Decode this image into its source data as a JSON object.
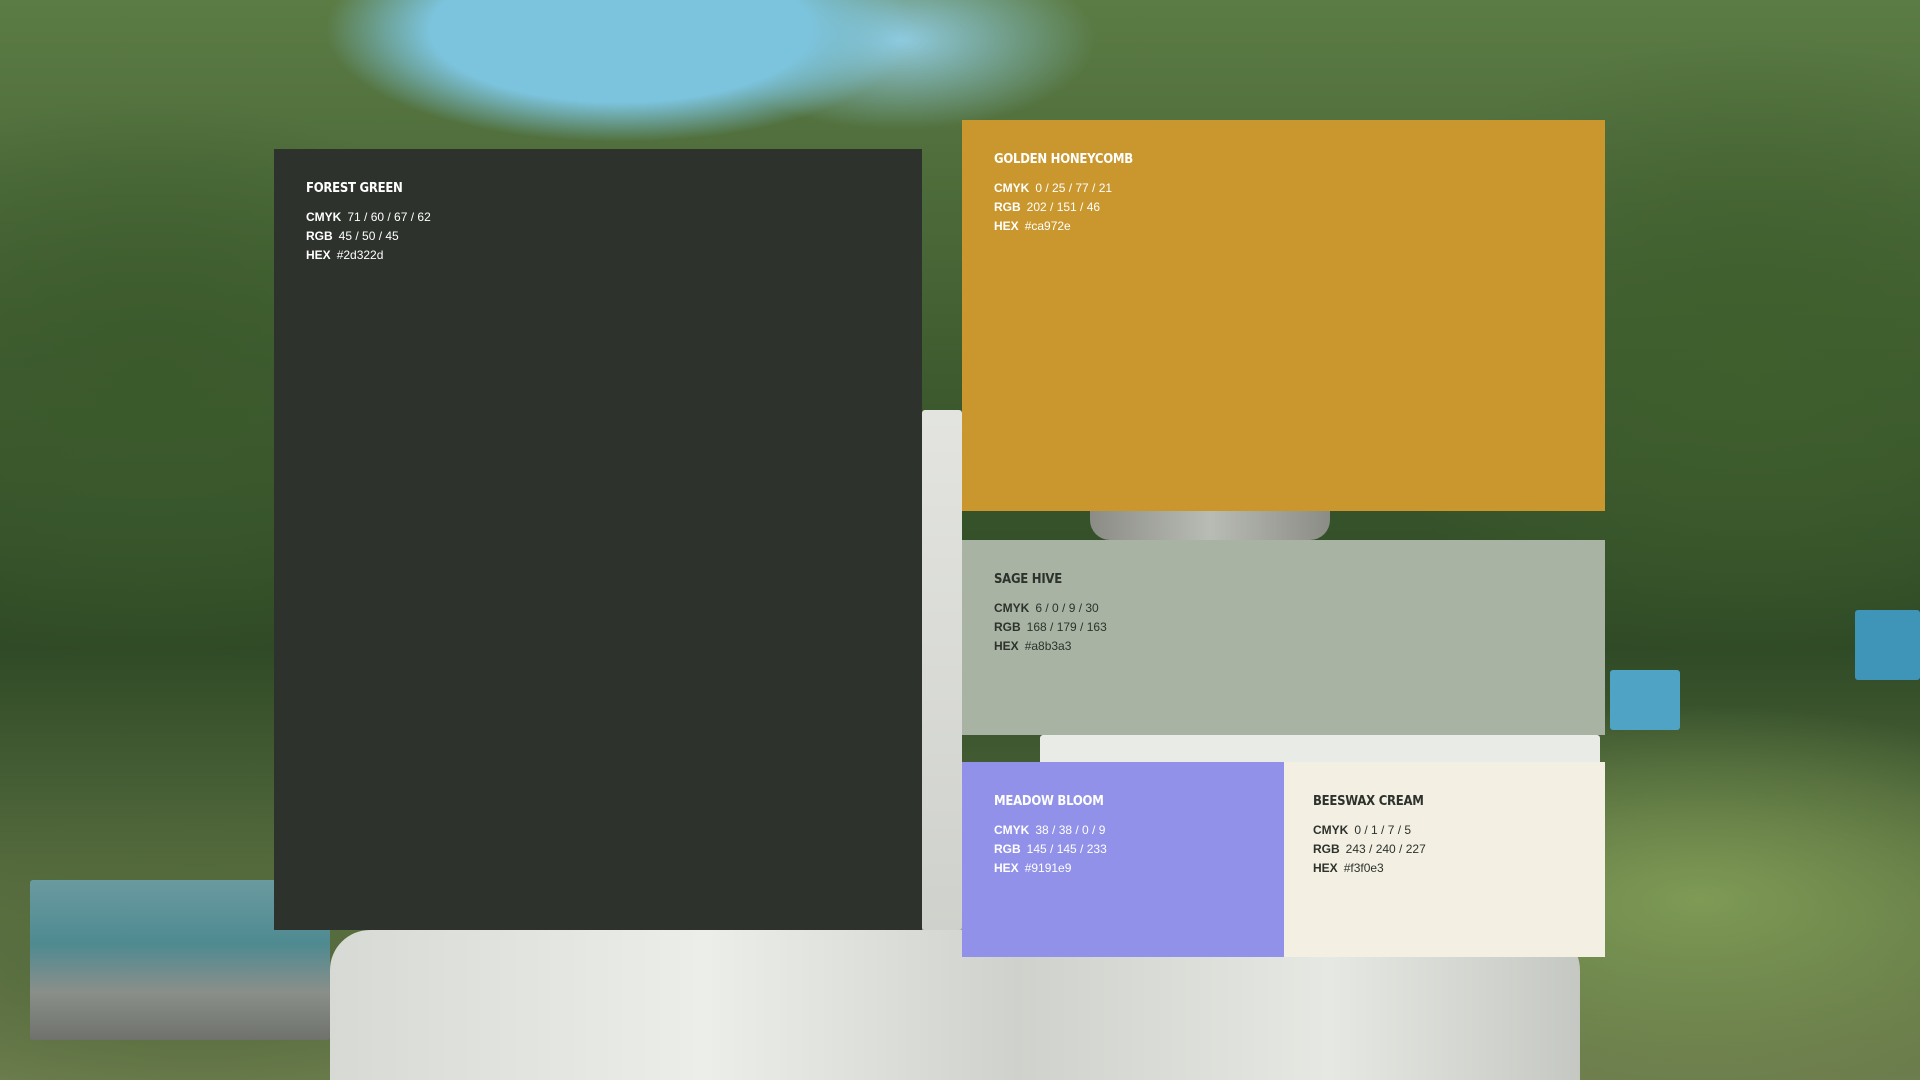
{
  "swatches": [
    {
      "name": "FOREST GREEN",
      "color": "#2d322d",
      "cmyk_label": "CMYK",
      "cmyk": "71 / 60 / 67 / 62",
      "rgb_label": "RGB",
      "rgb": "45 / 50 / 45",
      "hex_label": "HEX",
      "hex": "#2d322d"
    },
    {
      "name": "GOLDEN HONEYCOMB",
      "color": "#ca972e",
      "cmyk_label": "CMYK",
      "cmyk": "0 / 25 / 77 / 21",
      "rgb_label": "RGB",
      "rgb": "202 / 151 / 46",
      "hex_label": "HEX",
      "hex": "#ca972e"
    },
    {
      "name": "SAGE HIVE",
      "color": "#a8b3a3",
      "cmyk_label": "CMYK",
      "cmyk": "6 / 0 / 9 / 30",
      "rgb_label": "RGB",
      "rgb": "168 / 179 / 163",
      "hex_label": "HEX",
      "hex": "#a8b3a3"
    },
    {
      "name": "MEADOW BLOOM",
      "color": "#9191e9",
      "cmyk_label": "CMYK",
      "cmyk": "38 / 38 / 0 / 9",
      "rgb_label": "RGB",
      "rgb": "145 / 145 / 233",
      "hex_label": "HEX",
      "hex": "#9191e9"
    },
    {
      "name": "BEESWAX CREAM",
      "color": "#f3f0e3",
      "cmyk_label": "CMYK",
      "cmyk": "0 / 1 / 7 / 5",
      "rgb_label": "RGB",
      "rgb": "243 / 240 / 227",
      "hex_label": "HEX",
      "hex": "#f3f0e3"
    }
  ]
}
